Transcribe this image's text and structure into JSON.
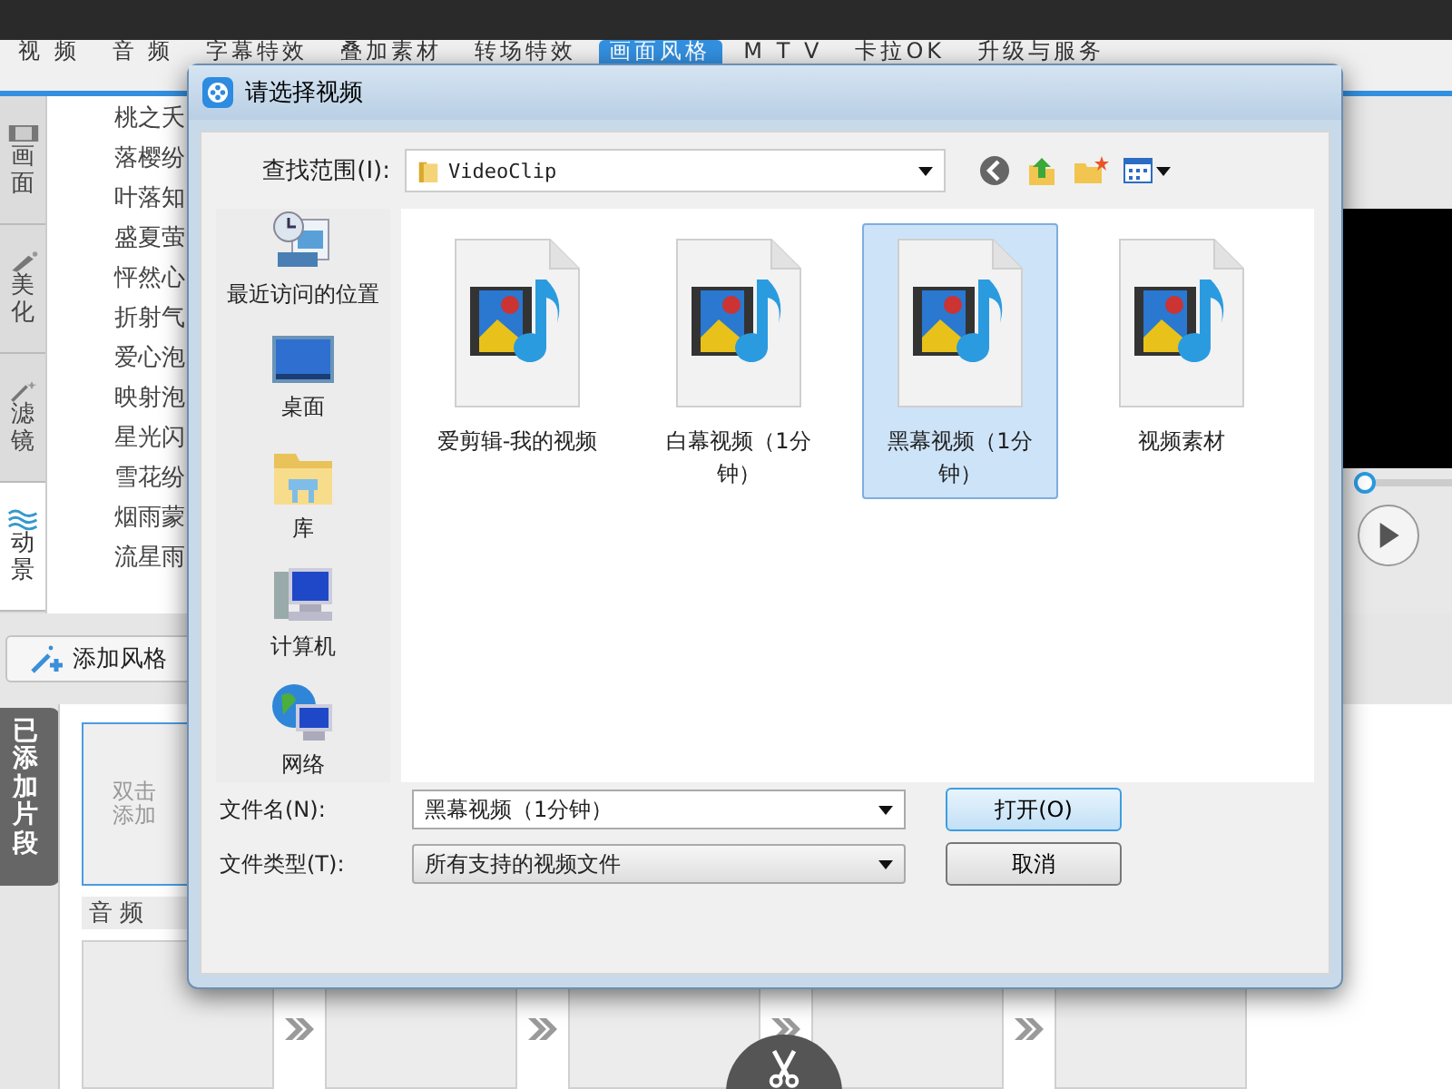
{
  "app": {
    "tabs": [
      {
        "label": "视 频",
        "selected": false
      },
      {
        "label": "音 频",
        "selected": false
      },
      {
        "label": "字幕特效",
        "selected": false
      },
      {
        "label": "叠加素材",
        "selected": false
      },
      {
        "label": "转场特效",
        "selected": false
      },
      {
        "label": "画面风格",
        "selected": true
      },
      {
        "label": "M T V",
        "selected": false
      },
      {
        "label": "卡拉OK",
        "selected": false
      },
      {
        "label": "升级与服务",
        "selected": false
      }
    ],
    "side_tabs": [
      {
        "label": "画面",
        "selected": false
      },
      {
        "label": "美化",
        "selected": false
      },
      {
        "label": "滤镜",
        "selected": false
      },
      {
        "label": "动景",
        "selected": true
      }
    ],
    "effects": [
      "桃之夭",
      "落樱纷",
      "叶落知",
      "盛夏萤",
      "怦然心",
      "折射气",
      "爱心泡",
      "映射泡",
      "星光闪",
      "雪花纷",
      "烟雨蒙",
      "流星雨"
    ],
    "add_style_button": "添加风格",
    "clips_tab": "已添加片段",
    "clip_placeholder": [
      "双击",
      "添加"
    ],
    "audio_label": "音 频",
    "preview": {
      "level": 0.0
    }
  },
  "dialog": {
    "title": "请选择视频",
    "look_in_label": "查找范围(I):",
    "look_in_value": "VideoClip",
    "places": [
      "最近访问的位置",
      "桌面",
      "库",
      "计算机",
      "网络"
    ],
    "files": [
      {
        "name": "爱剪辑-我的视频",
        "selected": false
      },
      {
        "name": "白幕视频（1分钟）",
        "selected": false
      },
      {
        "name": "黑幕视频（1分钟）",
        "selected": true
      },
      {
        "name": "视频素材",
        "selected": false
      }
    ],
    "file_name_label": "文件名(N):",
    "file_name_value": "黑幕视频（1分钟）",
    "file_type_label": "文件类型(T):",
    "file_type_value": "所有支持的视频文件",
    "open_button": "打开(O)",
    "cancel_button": "取消"
  }
}
